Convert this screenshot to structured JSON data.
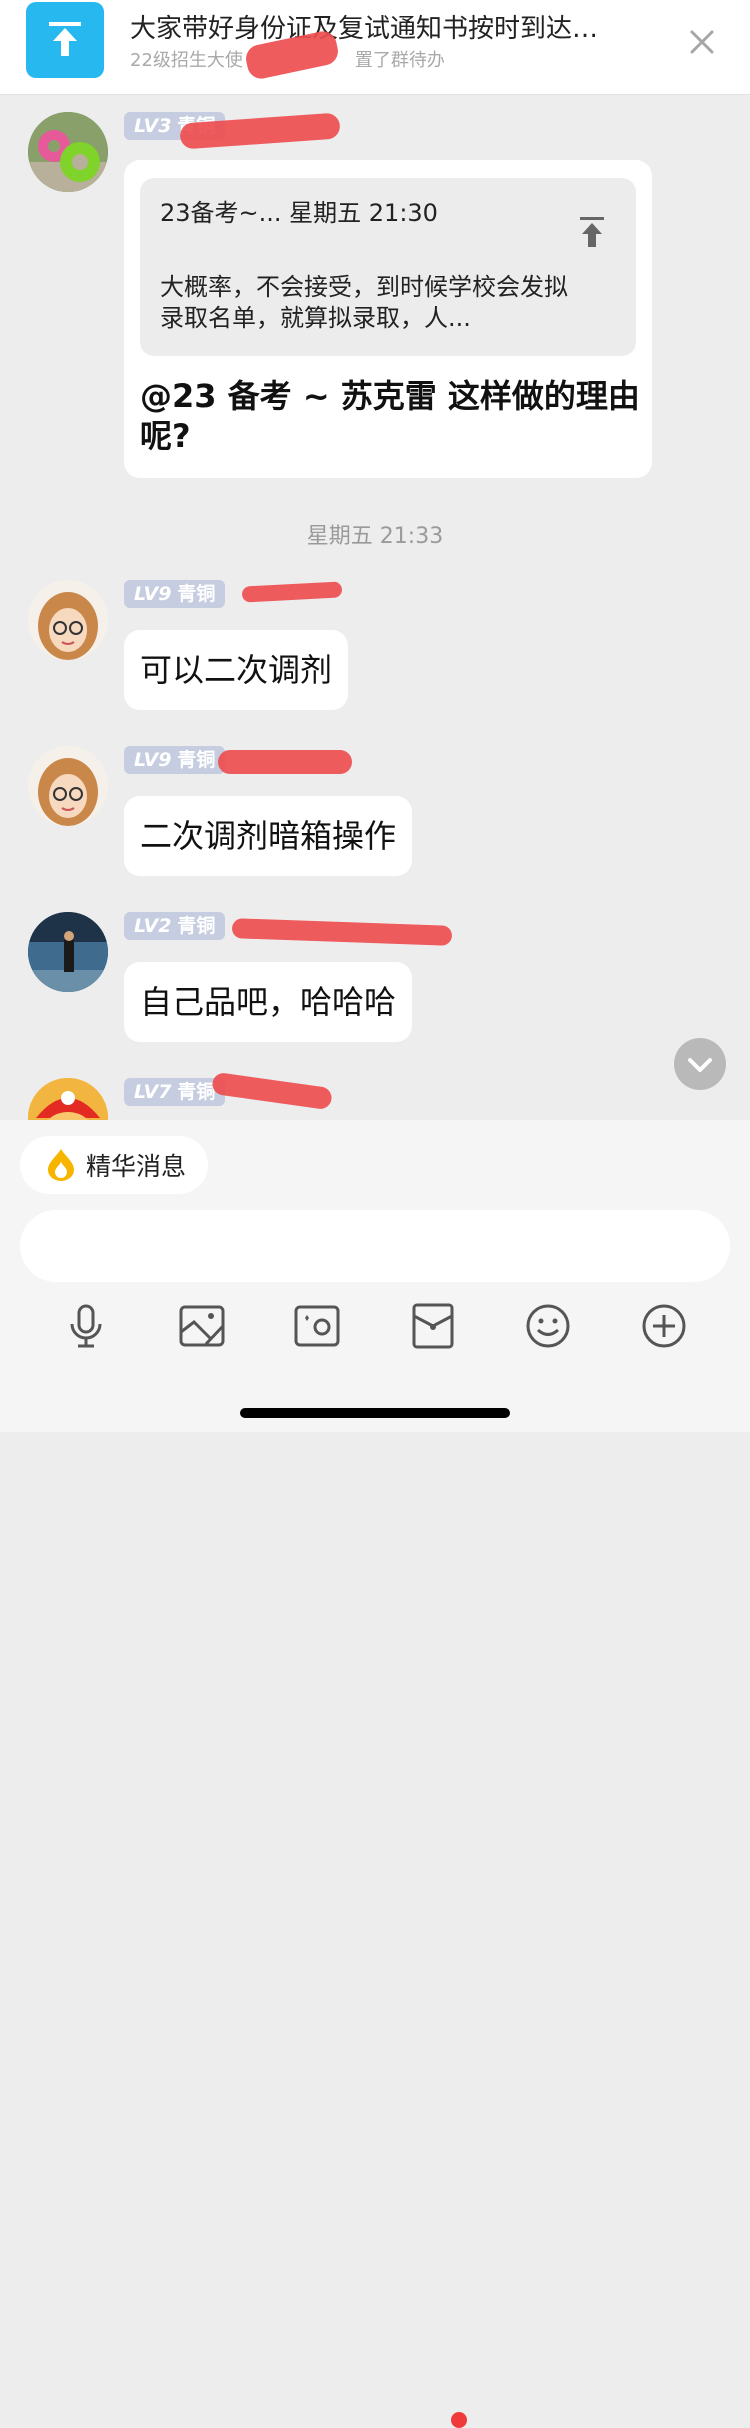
{
  "pinned": {
    "title": "大家带好身份证及复试通知书按时到达…",
    "subtitle": "22级招生大使",
    "subtitle_tail": "置了群待办"
  },
  "messages": [
    {
      "level": "LV3",
      "rank": "青铜",
      "quote": {
        "head": "23备考~... 星期五 21:30",
        "body": "大概率，不会接受，到时候学校会发拟录取名单，就算拟录取，人..."
      },
      "text": "@23 备考 ~ 苏克雷 这样做的理由呢?"
    },
    {
      "level": "LV9",
      "rank": "青铜",
      "text": "可以二次调剂"
    },
    {
      "level": "LV9",
      "rank": "青铜",
      "text": "二次调剂暗箱操作"
    },
    {
      "level": "LV2",
      "rank": "青铜",
      "text": "自己品吧，哈哈哈"
    },
    {
      "level": "LV7",
      "rank": "青铜"
    }
  ],
  "timestamp": "星期五 21:33",
  "essence_label": "精华消息",
  "toolbar_icons": [
    "microphone-icon",
    "image-icon",
    "camera-icon",
    "red-packet-icon",
    "emoji-icon",
    "plus-icon"
  ],
  "colors": {
    "accent": "#27b8f0",
    "level_badge": "#c6cde0",
    "redaction": "#ee4e50",
    "chat_bg": "#ededed"
  }
}
